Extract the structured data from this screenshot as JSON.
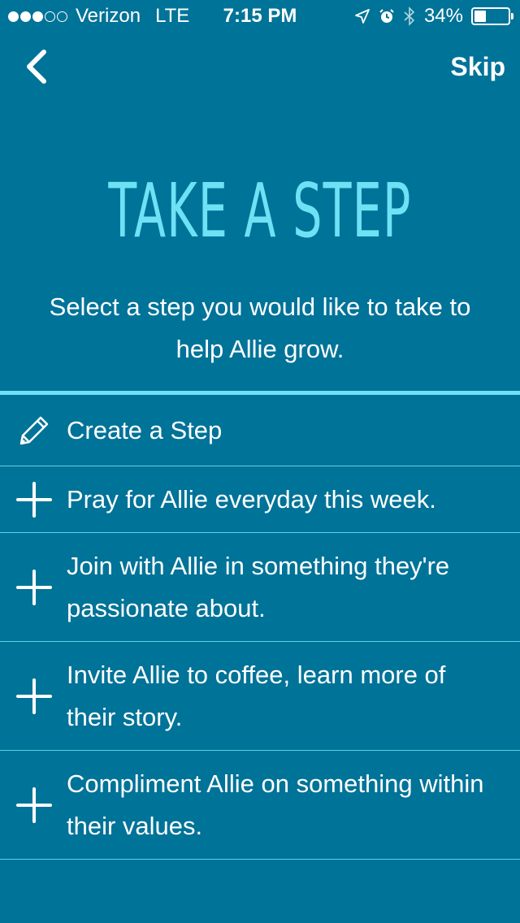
{
  "status_bar": {
    "carrier": "Verizon",
    "network": "LTE",
    "time": "7:15 PM",
    "battery_percent": "34%",
    "battery_level": 0.34,
    "signal_bars_filled": 3,
    "signal_bars_total": 5
  },
  "nav": {
    "skip_label": "Skip"
  },
  "header": {
    "title": "TAKE A STEP",
    "subtitle": "Select a step you would like to take to help Allie grow."
  },
  "steps": [
    {
      "label": "Create a Step",
      "icon": "pencil-icon"
    },
    {
      "label": "Pray for Allie everyday this week.",
      "icon": "plus-icon"
    },
    {
      "label": "Join with Allie in something they're passionate about.",
      "icon": "plus-icon"
    },
    {
      "label": "Invite Allie to coffee, learn more of their story.",
      "icon": "plus-icon"
    },
    {
      "label": "Compliment Allie on something within their values.",
      "icon": "plus-icon"
    }
  ],
  "colors": {
    "background": "#007398",
    "accent": "#6fe1f5",
    "text": "#ffffff"
  }
}
